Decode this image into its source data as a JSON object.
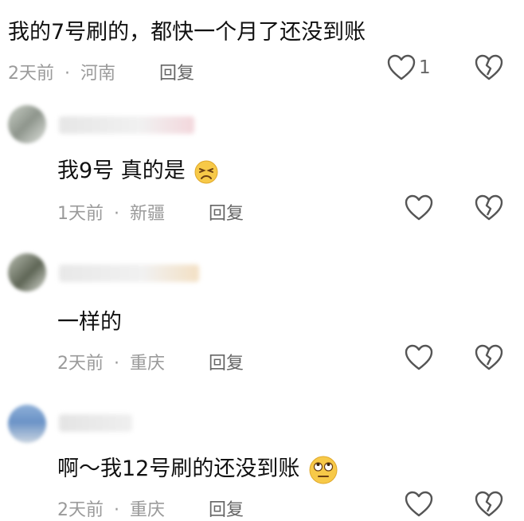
{
  "comments": [
    {
      "text": "我的7号刷的，都快一个月了还没到账",
      "time": "2天前",
      "location": "河南",
      "reply_label": "回复",
      "like_count": "1"
    },
    {
      "text": "我9号 真的是",
      "emoji": "persevering-face-emoji",
      "time": "1天前",
      "location": "新疆",
      "reply_label": "回复",
      "like_count": ""
    },
    {
      "text": "一样的",
      "time": "2天前",
      "location": "重庆",
      "reply_label": "回复",
      "like_count": ""
    },
    {
      "text": "啊～我12号刷的还没到账",
      "emoji": "eye-roll-face-emoji",
      "time": "2天前",
      "location": "重庆",
      "reply_label": "回复",
      "like_count": ""
    }
  ],
  "separator": "·",
  "icons": {
    "like": "heart-outline-icon",
    "dislike": "broken-heart-icon"
  },
  "colors": {
    "text": "#111111",
    "meta": "#9a9a9a",
    "icon": "#555555",
    "emoji_face": "#f7c948"
  }
}
